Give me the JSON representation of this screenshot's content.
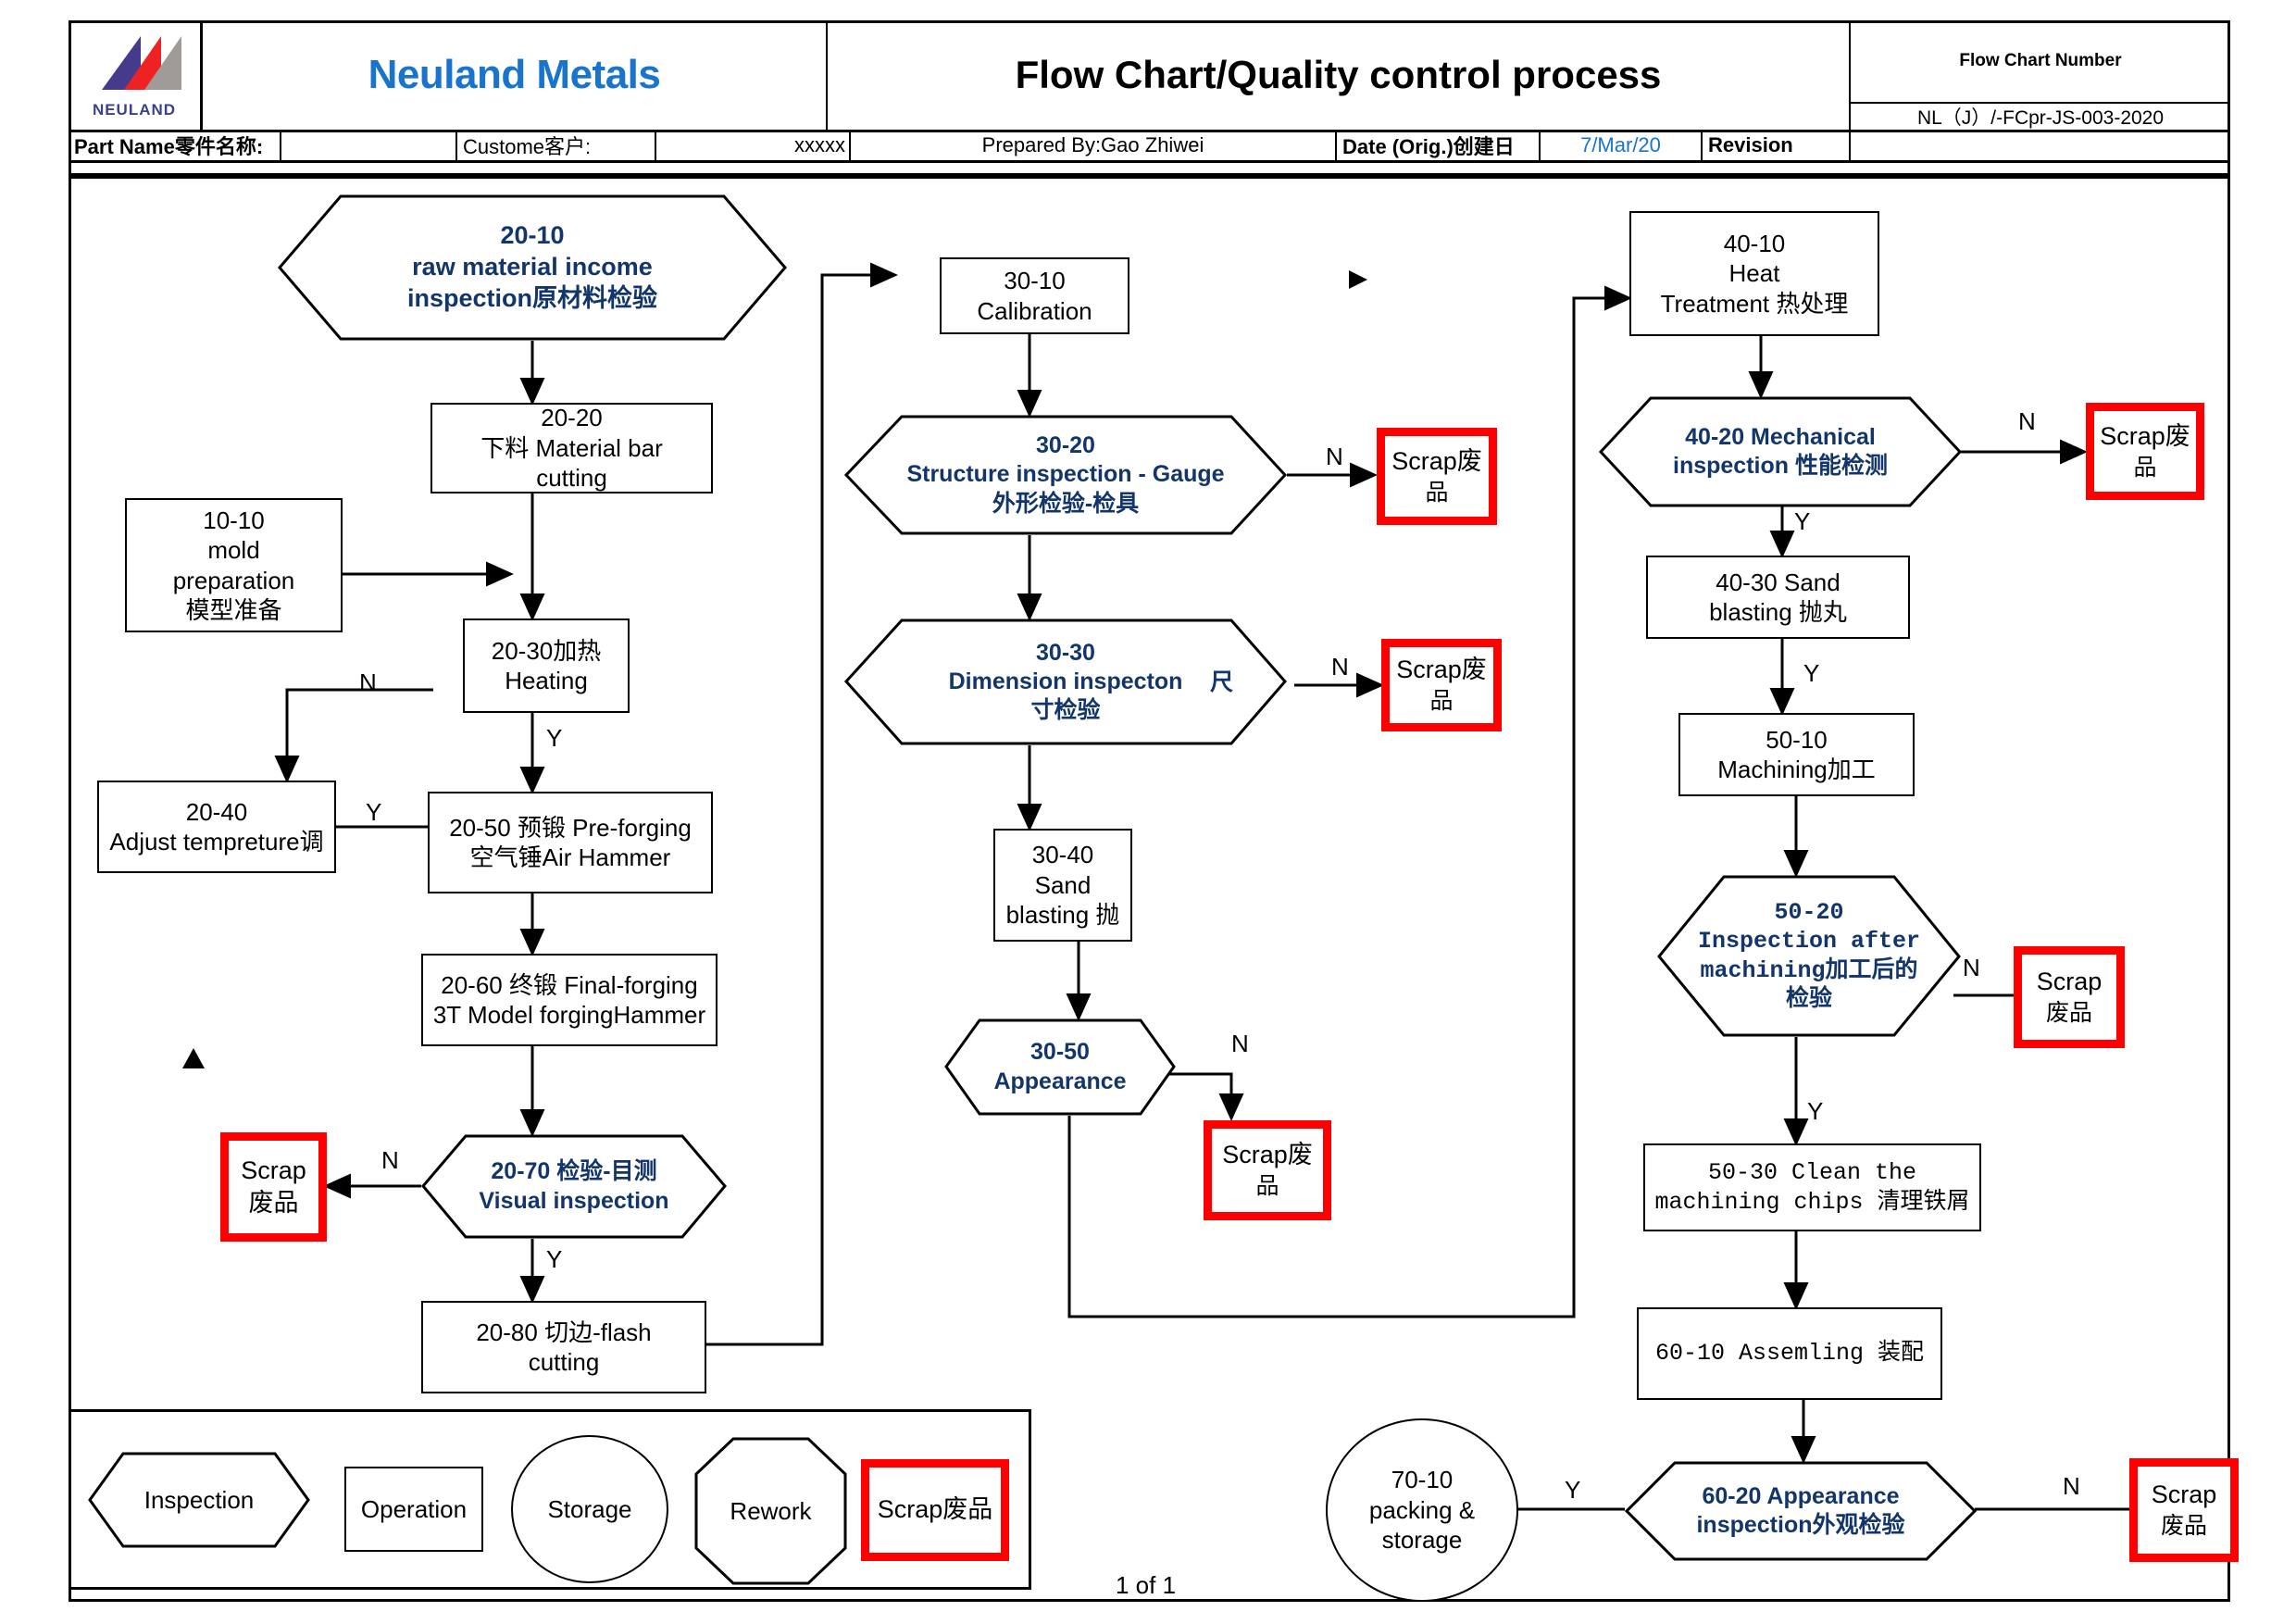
{
  "header": {
    "logo_text": "NEULAND",
    "company": "Neuland Metals",
    "title": "Flow Chart/Quality control process",
    "flow_chart_number_label": "Flow Chart Number",
    "flow_chart_number": "NL（J）/-FCpr-JS-003-2020",
    "part_name_label": "Part Name零件名称:",
    "part_name_value": "",
    "customer_label": "Custome客户:",
    "customer_value": "xxxxx",
    "prepared_by": "Prepared By:Gao Zhiwei",
    "date_label": "Date (Orig.)创建日",
    "date_value": "7/Mar/20",
    "revision_label": "Revision",
    "revision_value": ""
  },
  "nodes": {
    "n2010": {
      "line1": "20-10",
      "line2": "raw material income",
      "line3": "inspection原材料检验"
    },
    "n2020": {
      "line1": "20-20",
      "line2": "下料 Material bar",
      "line3": "cutting"
    },
    "n1010": {
      "line1": "10-10",
      "line2": "mold",
      "line3": "preparation",
      "line4": "模型准备"
    },
    "n2030": {
      "line1": "20-30加热",
      "line2": "Heating"
    },
    "n2040": {
      "line1": "20-40",
      "line2": "Adjust tempreture调"
    },
    "n2050": {
      "line1": "20-50 预锻 Pre-forging",
      "line2": "空气锤Air Hammer"
    },
    "n2060": {
      "line1": "20-60 终锻 Final-forging",
      "line2": "3T Model forgingHammer"
    },
    "n2070": {
      "line1": "20-70 检验-目测",
      "line2": "Visual inspection"
    },
    "n2080": {
      "line1": "20-80 切边-flash",
      "line2": "cutting"
    },
    "n3010": {
      "line1": "30-10",
      "line2": "Calibration"
    },
    "n3020": {
      "line1": "30-20",
      "line2": "Structure inspection - Gauge",
      "line3": "外形检验-检具"
    },
    "n3030": {
      "line1": "30-30",
      "line2": "Dimension inspecton",
      "line2b": "尺",
      "line3": "寸检验"
    },
    "n3040": {
      "line1": "30-40",
      "line2": "Sand",
      "line3": "blasting 抛"
    },
    "n3050": {
      "line1": "30-50",
      "line2": "Appearance"
    },
    "n4010": {
      "line1": "40-10",
      "line2": "Heat",
      "line3": "Treatment 热处理"
    },
    "n4020": {
      "line1": "40-20 Mechanical",
      "line2": "inspection 性能检测"
    },
    "n4030": {
      "line1": "40-30 Sand",
      "line2": "blasting 抛丸"
    },
    "n5010": {
      "line1": "50-10",
      "line2": "Machining加工"
    },
    "n5020": {
      "line1": "50-20",
      "line2": "Inspection after",
      "line3": "machining加工后的",
      "line4": "检验"
    },
    "n5030": {
      "line1": "50-30 Clean the",
      "line2": "machining chips 清理铁屑"
    },
    "n6010": {
      "line1": "60-10 Assemling 装配"
    },
    "n6020": {
      "line1": "60-20 Appearance",
      "line2": "inspection外观检验"
    },
    "n7010": {
      "line1": "70-10",
      "line2": "packing &",
      "line3": "storage"
    }
  },
  "scrap": {
    "s1": {
      "line1": "Scrap",
      "line2": "废品"
    },
    "s2": {
      "line1": "Scrap废",
      "line2": "品"
    },
    "s3": {
      "line1": "Scrap废",
      "line2": "品"
    },
    "s4": {
      "line1": "Scrap废",
      "line2": "品"
    },
    "s5": {
      "line1": "Scrap废",
      "line2": "品"
    },
    "s6": {
      "line1": "Scrap",
      "line2": "废品"
    },
    "s7": {
      "line1": "Scrap",
      "line2": "废品"
    }
  },
  "edge_labels": {
    "y1": "Y",
    "y2": "Y",
    "y3": "Y",
    "y4": "Y",
    "y5": "Y",
    "y6": "Y",
    "y7": "Y",
    "n1": "N",
    "n2": "N",
    "n3": "N",
    "n4": "N",
    "n5": "N",
    "n6": "N",
    "n7": "N"
  },
  "legend": {
    "inspection": "Inspection",
    "operation": "Operation",
    "storage": "Storage",
    "rework": "Rework",
    "scrap": "Scrap废品"
  },
  "footer": {
    "page": "1 of 1"
  },
  "colors": {
    "brand_blue": "#1874cd",
    "node_blue": "#12356b",
    "scrap_red": "#ff0000",
    "logo_purple": "#453a8c",
    "logo_red": "#ee2222",
    "logo_grey": "#a09a98"
  }
}
